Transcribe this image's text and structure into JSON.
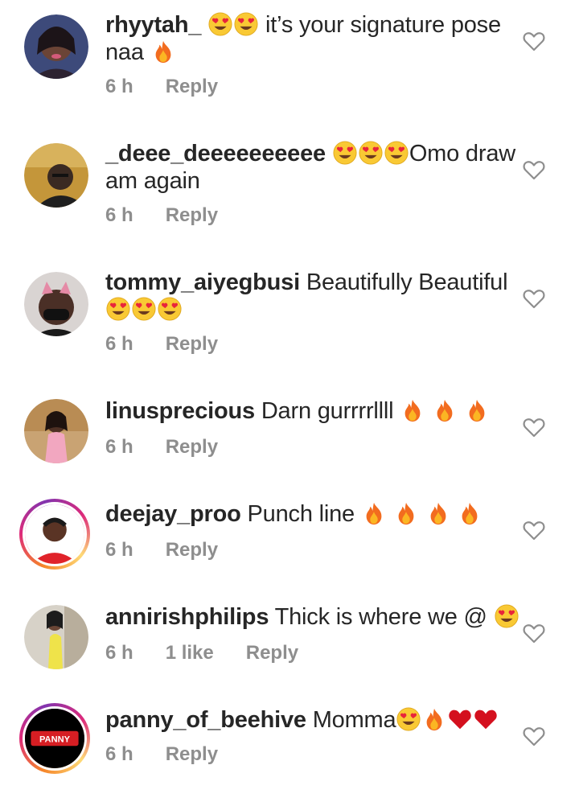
{
  "comments": [
    {
      "username": "rhyytah_",
      "text": "it’s your signature pose naa",
      "time": "6 h",
      "likes": "",
      "reply": "Reply"
    },
    {
      "username": "_deee_deeeeeeeeee",
      "text": "Omo draw am again",
      "time": "6 h",
      "likes": "",
      "reply": "Reply"
    },
    {
      "username": "tommy_aiyegbusi",
      "text": "Beautifully Beautiful",
      "time": "6 h",
      "likes": "",
      "reply": "Reply"
    },
    {
      "username": "linusprecious",
      "text": "Darn gurrrrllll",
      "time": "6 h",
      "likes": "",
      "reply": "Reply"
    },
    {
      "username": "deejay_proo",
      "text": "Punch line",
      "time": "6 h",
      "likes": "",
      "reply": "Reply"
    },
    {
      "username": "annirishphilips",
      "text": "Thick is where we @",
      "time": "6 h",
      "likes": "1 like",
      "reply": "Reply"
    },
    {
      "username": "panny_of_beehive",
      "text": "Momma",
      "time": "6 h",
      "likes": "",
      "reply": "Reply",
      "avatar_text": "PANNY"
    }
  ],
  "colors": {
    "text": "#262626",
    "meta": "#8e8e8e",
    "heart_outline": "#8e8e8e"
  },
  "icons": {
    "like": "heart-outline-icon",
    "emoji_love": "heart-eyes-emoji",
    "emoji_fire": "fire-emoji",
    "emoji_red_heart": "red-heart-emoji"
  }
}
